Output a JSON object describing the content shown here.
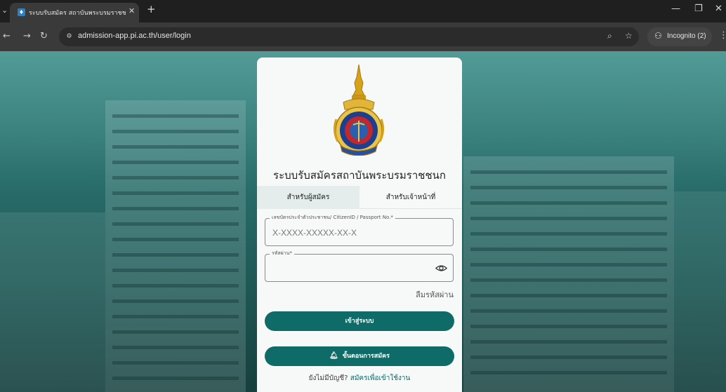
{
  "browser": {
    "tab_title": "ระบบรับสมัคร สถาบันพระบรมราชชน",
    "url": "admission-app.pi.ac.th/user/login",
    "incognito_label": "Incognito (2)"
  },
  "login": {
    "title": "ระบบรับสมัครสถาบันพระบรมราชชนก",
    "tabs": [
      "สำหรับผู้สมัคร",
      "สำหรับเจ้าหน้าที่"
    ],
    "active_tab": 0,
    "citizen_id_label": "เลขบัตรประจำตัวประชาชน/ CitizenID / Passport No.*",
    "citizen_id_placeholder": "X-XXXX-XXXXX-XX-X",
    "password_label": "รหัสผ่าน*",
    "forgot_password": "ลืมรหัสผ่าน",
    "login_button": "เข้าสู่ระบบ",
    "steps_button": "ขั้นตอนการสมัคร",
    "no_account_text": "ยังไม่มีบัญชี?",
    "signup_link": "สมัครเพื่อเข้าใช้งาน"
  },
  "colors": {
    "primary": "#0f6b67",
    "background_tint": "#2a6f6c",
    "card": "#f7f8f8"
  },
  "icons": {
    "site_info": "tune-icon",
    "zoom": "zoom-icon",
    "bookmark": "star-icon",
    "incognito": "incognito-icon",
    "password_toggle": "eye-icon",
    "steps": "bell-icon"
  }
}
